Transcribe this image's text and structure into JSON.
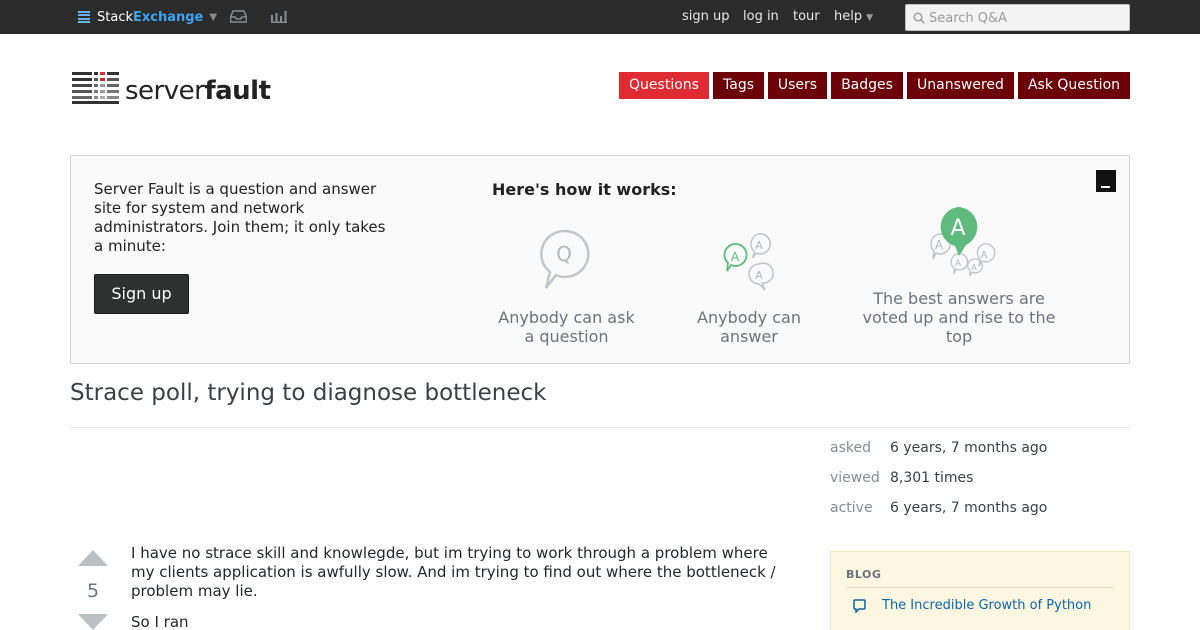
{
  "topbar": {
    "logo_stack": "Stack",
    "logo_exchange": "Exchange",
    "links": [
      "sign up",
      "log in",
      "tour",
      "help"
    ],
    "search_placeholder": "Search Q&A"
  },
  "header": {
    "logo_light": "server",
    "logo_bold": "fault",
    "nav": [
      "Questions",
      "Tags",
      "Users",
      "Badges",
      "Unanswered",
      "Ask Question"
    ],
    "active_nav": "Questions"
  },
  "welcome": {
    "text": "Server Fault is a question and answer site for system and network administrators. Join them; it only takes a minute:",
    "signup_label": "Sign up",
    "how_title": "Here's how it works:",
    "close_glyph": "_",
    "steps": [
      {
        "caption": "Anybody can ask a question",
        "icon_letter": "Q"
      },
      {
        "caption": "Anybody can answer",
        "icon_letter": "A"
      },
      {
        "caption": "The best answers are voted up and rise to the top",
        "icon_letter": "A"
      }
    ]
  },
  "question": {
    "title": "Strace poll, trying to diagnose bottleneck",
    "votes": "5",
    "body_p1": "I have no strace skill and knowlegde, but im trying to work through a problem where my clients application is awfully slow. And im trying to find out where the bottleneck / problem may lie.",
    "body_p2": "So I ran"
  },
  "meta": {
    "asked_label": "asked",
    "asked_value": "6 years, 7 months ago",
    "viewed_label": "viewed",
    "viewed_value": "8,301 times",
    "active_label": "active",
    "active_value": "6 years, 7 months ago"
  },
  "blog": {
    "heading": "BLOG",
    "link": "The Incredible Growth of Python"
  },
  "colors": {
    "topbar": "#2b2b2b",
    "nav_button": "#6b0008",
    "nav_active": "#e12b32",
    "accent_green": "#5eba7d",
    "link_blue": "#0c65a5"
  }
}
